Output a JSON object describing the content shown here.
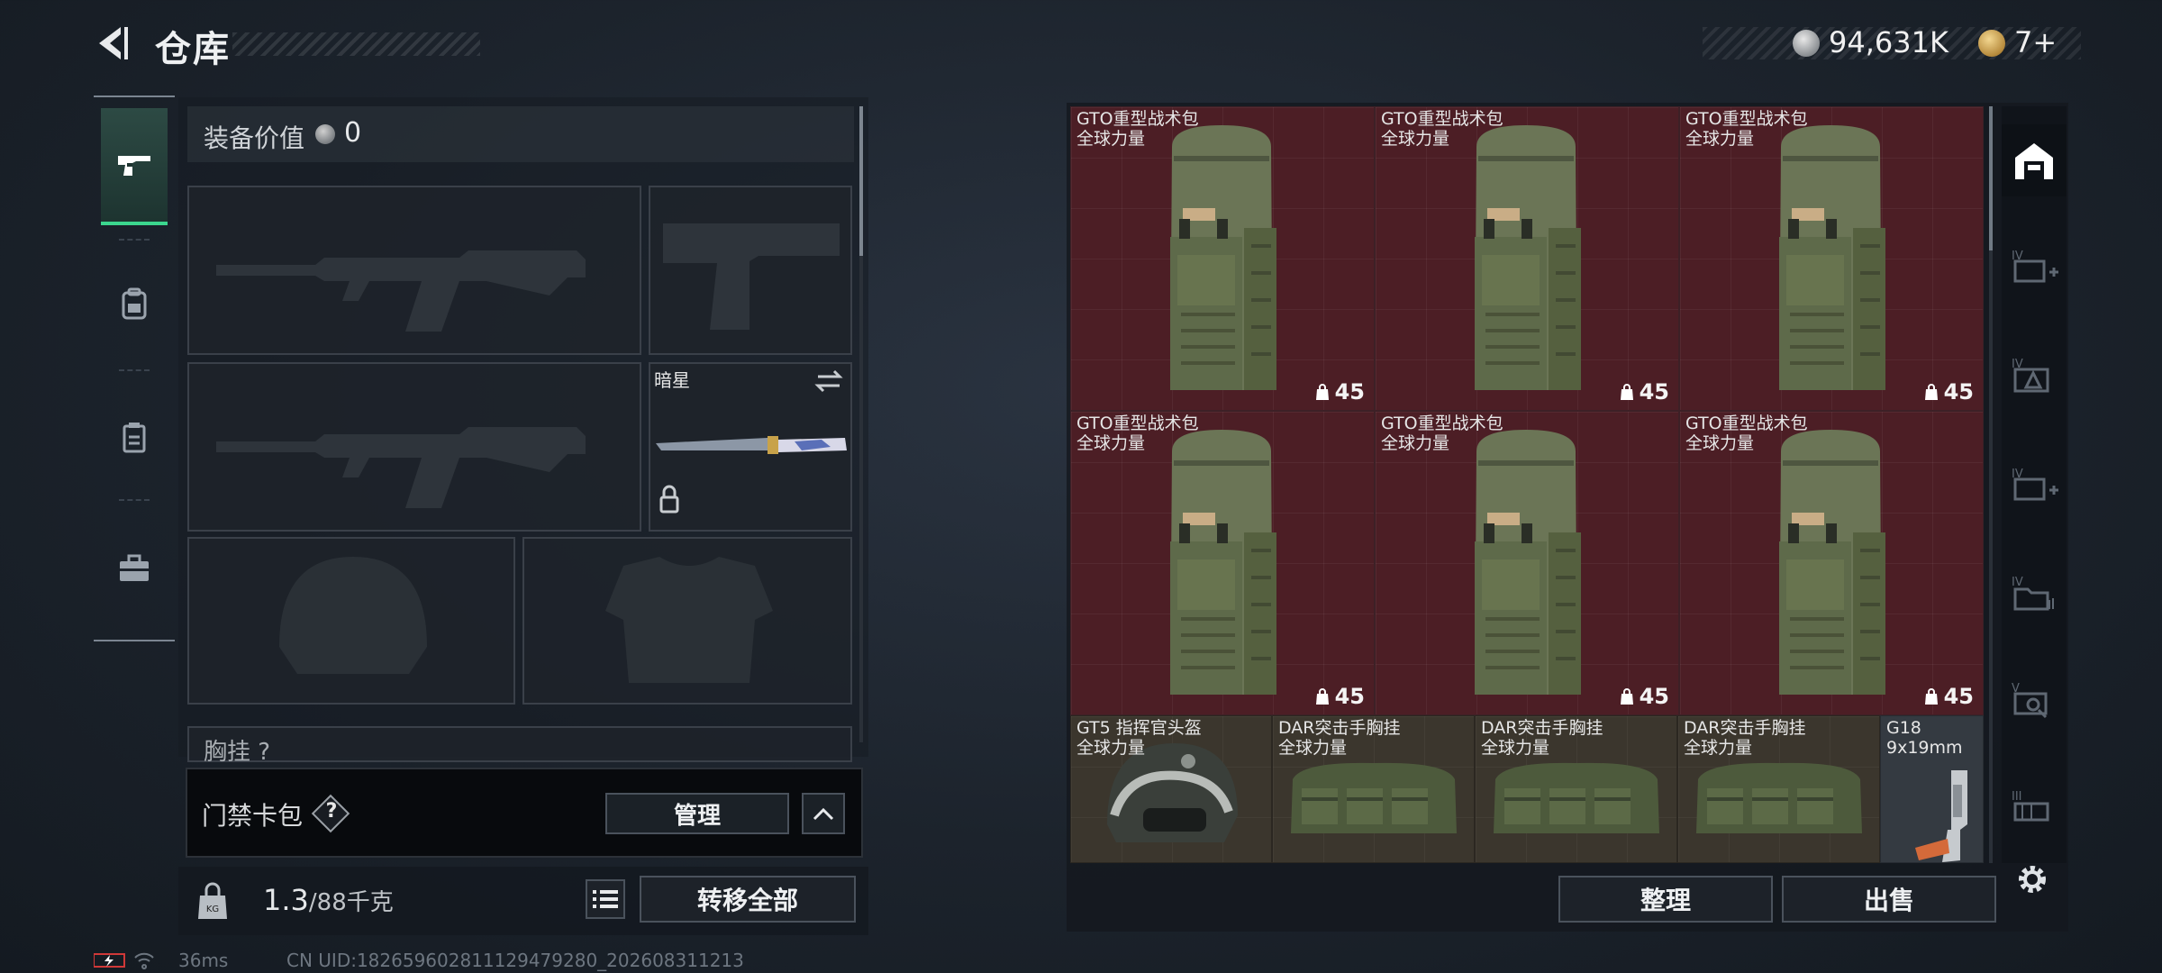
{
  "header": {
    "title": "仓库",
    "money": "94,631K",
    "tickets": "7+"
  },
  "loadout": {
    "equip_value_label": "装备价值",
    "equip_value": "0",
    "melee_name": "暗星",
    "chest_label": "胸挂 ?"
  },
  "keycard": {
    "label": "门禁卡包",
    "help": "?",
    "manage": "管理"
  },
  "weight": {
    "current": "1.3",
    "capacity": "/88千克",
    "transfer_all": "转移全部"
  },
  "status": {
    "ping": "36ms",
    "uid": "CN UID:1826596028111294792​80_202608311213"
  },
  "storage": {
    "items": [
      {
        "name": "GTO重型战术包",
        "sub": "全球力量",
        "cap": "45",
        "type": "backpack"
      },
      {
        "name": "GTO重型战术包",
        "sub": "全球力量",
        "cap": "45",
        "type": "backpack"
      },
      {
        "name": "GTO重型战术包",
        "sub": "全球力量",
        "cap": "45",
        "type": "backpack"
      },
      {
        "name": "GTO重型战术包",
        "sub": "全球力量",
        "cap": "45",
        "type": "backpack"
      },
      {
        "name": "GTO重型战术包",
        "sub": "全球力量",
        "cap": "45",
        "type": "backpack"
      },
      {
        "name": "GTO重型战术包",
        "sub": "全球力量",
        "cap": "45",
        "type": "backpack"
      },
      {
        "name": "GT5 指挥官头盔",
        "sub": "全球力量",
        "type": "helmet"
      },
      {
        "name": "DAR突击手胸挂",
        "sub": "全球力量",
        "type": "vest"
      },
      {
        "name": "DAR突击手胸挂",
        "sub": "全球力量",
        "type": "vest"
      },
      {
        "name": "DAR突击手胸挂",
        "sub": "全球力量",
        "type": "vest"
      },
      {
        "name": "G18",
        "sub": "9x19mm",
        "type": "pistol"
      }
    ],
    "sort": "整理",
    "sell": "出售"
  },
  "colors": {
    "accent_green": "#3bd68e",
    "item_red": "#4c1e25",
    "item_tan": "#3b362d"
  }
}
